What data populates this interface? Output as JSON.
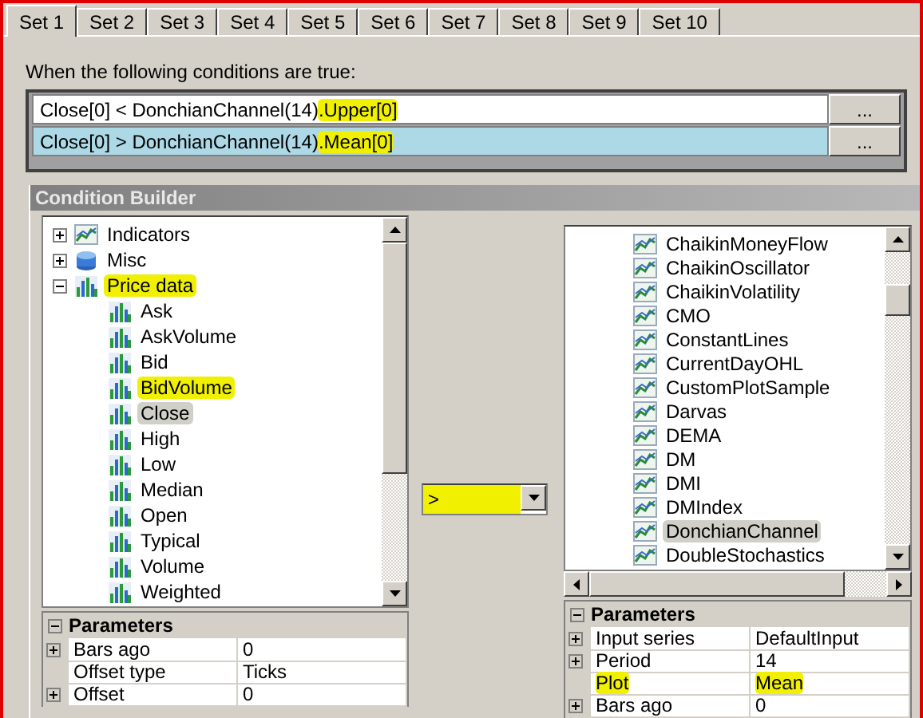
{
  "tabs": [
    {
      "label": "Set 1",
      "selected": true
    },
    {
      "label": "Set 2",
      "selected": false
    },
    {
      "label": "Set 3",
      "selected": false
    },
    {
      "label": "Set 4",
      "selected": false
    },
    {
      "label": "Set 5",
      "selected": false
    },
    {
      "label": "Set 6",
      "selected": false
    },
    {
      "label": "Set 7",
      "selected": false
    },
    {
      "label": "Set 8",
      "selected": false
    },
    {
      "label": "Set 9",
      "selected": false
    },
    {
      "label": "Set 10",
      "selected": false
    }
  ],
  "conditions_label": "When the following conditions are true:",
  "conditions": [
    {
      "selected": false,
      "button": "...",
      "parts": [
        {
          "text": "Close[0] < DonchianChannel(14)",
          "highlighted": false
        },
        {
          "text": ".Upper[0]",
          "highlighted": true
        }
      ]
    },
    {
      "selected": true,
      "button": "...",
      "parts": [
        {
          "text": "Close[0] > DonchianChannel(14)",
          "highlighted": false
        },
        {
          "text": ".Mean[0]",
          "highlighted": true
        }
      ]
    }
  ],
  "builder": {
    "title": "Condition Builder",
    "left_tree": [
      {
        "label": "Indicators",
        "kind": "indicator",
        "expanded": false,
        "selected": false,
        "highlighted": false
      },
      {
        "label": "Misc",
        "kind": "misc",
        "expanded": false,
        "selected": false,
        "highlighted": false
      },
      {
        "label": "Price data",
        "kind": "price",
        "expanded": true,
        "selected": false,
        "highlighted": true,
        "children": [
          {
            "label": "Ask",
            "kind": "price",
            "selected": false,
            "highlighted": false
          },
          {
            "label": "AskVolume",
            "kind": "price",
            "selected": false,
            "highlighted": false
          },
          {
            "label": "Bid",
            "kind": "price",
            "selected": false,
            "highlighted": false
          },
          {
            "label": "BidVolume",
            "kind": "price",
            "selected": false,
            "highlighted": true
          },
          {
            "label": "Close",
            "kind": "price",
            "selected": true,
            "highlighted": true
          },
          {
            "label": "High",
            "kind": "price",
            "selected": false,
            "highlighted": false
          },
          {
            "label": "Low",
            "kind": "price",
            "selected": false,
            "highlighted": false
          },
          {
            "label": "Median",
            "kind": "price",
            "selected": false,
            "highlighted": false
          },
          {
            "label": "Open",
            "kind": "price",
            "selected": false,
            "highlighted": false
          },
          {
            "label": "Typical",
            "kind": "price",
            "selected": false,
            "highlighted": false
          },
          {
            "label": "Volume",
            "kind": "price",
            "selected": false,
            "highlighted": false
          },
          {
            "label": "Weighted",
            "kind": "price",
            "selected": false,
            "highlighted": false
          }
        ]
      }
    ],
    "comparator": {
      "value": ">",
      "highlighted": true
    },
    "right_tree": [
      {
        "label": "ChaikinMoneyFlow",
        "kind": "indicator",
        "selected": false,
        "highlighted": false
      },
      {
        "label": "ChaikinOscillator",
        "kind": "indicator",
        "selected": false,
        "highlighted": false
      },
      {
        "label": "ChaikinVolatility",
        "kind": "indicator",
        "selected": false,
        "highlighted": false
      },
      {
        "label": "CMO",
        "kind": "indicator",
        "selected": false,
        "highlighted": false
      },
      {
        "label": "ConstantLines",
        "kind": "indicator",
        "selected": false,
        "highlighted": false
      },
      {
        "label": "CurrentDayOHL",
        "kind": "indicator",
        "selected": false,
        "highlighted": false
      },
      {
        "label": "CustomPlotSample",
        "kind": "indicator",
        "selected": false,
        "highlighted": false
      },
      {
        "label": "Darvas",
        "kind": "indicator",
        "selected": false,
        "highlighted": false
      },
      {
        "label": "DEMA",
        "kind": "indicator",
        "selected": false,
        "highlighted": false
      },
      {
        "label": "DM",
        "kind": "indicator",
        "selected": false,
        "highlighted": false
      },
      {
        "label": "DMI",
        "kind": "indicator",
        "selected": false,
        "highlighted": false
      },
      {
        "label": "DMIndex",
        "kind": "indicator",
        "selected": false,
        "highlighted": false
      },
      {
        "label": "DonchianChannel",
        "kind": "indicator",
        "selected": true,
        "highlighted": true
      },
      {
        "label": "DoubleStochastics",
        "kind": "indicator",
        "selected": false,
        "highlighted": false
      }
    ],
    "left_params": {
      "title": "Parameters",
      "expanded": true,
      "rows": [
        {
          "name": "Bars ago",
          "value": "0",
          "expandable": true,
          "highlighted": false
        },
        {
          "name": "Offset type",
          "value": "Ticks",
          "expandable": false,
          "highlighted": false
        },
        {
          "name": "Offset",
          "value": "0",
          "expandable": true,
          "highlighted": false
        }
      ]
    },
    "right_params": {
      "title": "Parameters",
      "expanded": true,
      "rows": [
        {
          "name": "Input series",
          "value": "DefaultInput",
          "expandable": true,
          "highlighted": false
        },
        {
          "name": "Period",
          "value": "14",
          "expandable": true,
          "highlighted": false
        },
        {
          "name": "Plot",
          "value": "Mean",
          "expandable": false,
          "highlighted": true
        },
        {
          "name": "Bars ago",
          "value": "0",
          "expandable": true,
          "highlighted": false
        }
      ]
    }
  }
}
